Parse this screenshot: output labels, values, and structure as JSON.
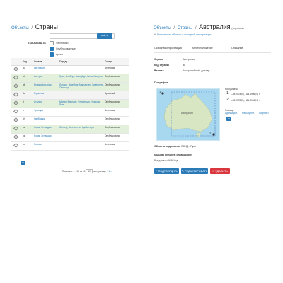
{
  "left": {
    "breadcrumb": "Объекты",
    "title": "Страны",
    "search": {
      "value": "",
      "placeholder": "",
      "button": "НАЙТИ"
    },
    "filter": {
      "label": "ПОКАЗЫВАТЬ",
      "options": [
        {
          "label": "Черновики",
          "checked": false
        },
        {
          "label": "Опубликованные",
          "checked": true
        },
        {
          "label": "Архив",
          "checked": true
        }
      ]
    },
    "table": {
      "headers": [
        "Код",
        "Страна",
        "Города",
        "Статус"
      ],
      "rows": [
        {
          "code": "au",
          "name": "Австралия",
          "regions": "",
          "status": "Черновик",
          "tone": "white"
        },
        {
          "code": "at",
          "name": "Австрия",
          "regions": "Грац, Инсбрук, Зальцбург, Вена, Австрия",
          "status": "Опубликовано",
          "tone": "green"
        },
        {
          "code": "gb",
          "name": "Великобритания",
          "regions": "Лондон, Эдинбург, Манчестер, Ливерпуль, Оксфорд",
          "status": "Опубликовано",
          "tone": "green"
        },
        {
          "code": "de",
          "name": "Германия",
          "regions": "",
          "status": "Архивный",
          "tone": "gray"
        },
        {
          "code": "it",
          "name": "Италия",
          "regions": "Милан, Венеция, Флоренция, Неаполь, Рим",
          "status": "Опубликовано",
          "tone": "green"
        },
        {
          "code": "fr",
          "name": "Франция",
          "regions": "",
          "status": "Черновик",
          "tone": "white"
        },
        {
          "code": "kh",
          "name": "Камбоджа",
          "regions": "",
          "status": "Опубликовано",
          "tone": "white"
        },
        {
          "code": "nz",
          "name": "Новая Зеландия",
          "regions": "Окленд, Веллингтон, Крайстчерч",
          "status": "Опубликовано",
          "tone": "green"
        },
        {
          "code": "nz",
          "name": "Новая Зеландия",
          "regions": "",
          "status": "Опубликовано",
          "tone": "white"
        },
        {
          "code": "ru",
          "name": "Россия",
          "regions": "",
          "status": "Черновик",
          "tone": "white"
        }
      ]
    },
    "pager": {
      "label": "Показано: 1 - 10 из 10",
      "per_page": "10",
      "per_page_label": "на странице",
      "pages": [
        "«",
        "1",
        "»"
      ]
    }
  },
  "right": {
    "breadcrumb": [
      "Объекты",
      "Страны"
    ],
    "title": "Австралия",
    "title_note": "(черновик)",
    "info_link": "Посмотреть обратно в исходной информации",
    "tabs": [
      "Основная информация",
      "Местоположение",
      "Описание"
    ],
    "fields": [
      {
        "key": "Страна",
        "value": "Австралия"
      },
      {
        "key": "Код страны",
        "value": "au"
      },
      {
        "key": "Валюта",
        "value": "Австралийский доллар"
      }
    ],
    "geo_label": "География",
    "map": {
      "country": "Австралия",
      "markers": [
        "1",
        "2"
      ]
    },
    "coords_label": "Координаты",
    "coords": [
      {
        "n": "1",
        "value": "–28.2178(E) , 114.4906(N) ✕"
      },
      {
        "n": "2",
        "value": "–28.2178(E) , 114.4906(N) ✕"
      }
    ],
    "borders_label": "Граница",
    "borders": [
      "Аделаида ×",
      "Мельбурн ×",
      "Сидней ×"
    ],
    "visibility": {
      "label": "Область видимости:",
      "value": "ССИД : Руки"
    },
    "comment": {
      "label": "Коды во внешнем справочнике:",
      "value": "Все данные ОКФН Год"
    },
    "actions": [
      {
        "label": "ПОДТВЕРДИТЬ",
        "icon": "check-icon",
        "color": "#2a7ab8"
      },
      {
        "label": "РЕДАКТИРОВАТЬ",
        "icon": "pencil-icon",
        "color": "#2a7ab8"
      },
      {
        "label": "УДАЛИТЬ",
        "icon": "trash-icon",
        "color": "#d9363e"
      }
    ]
  }
}
